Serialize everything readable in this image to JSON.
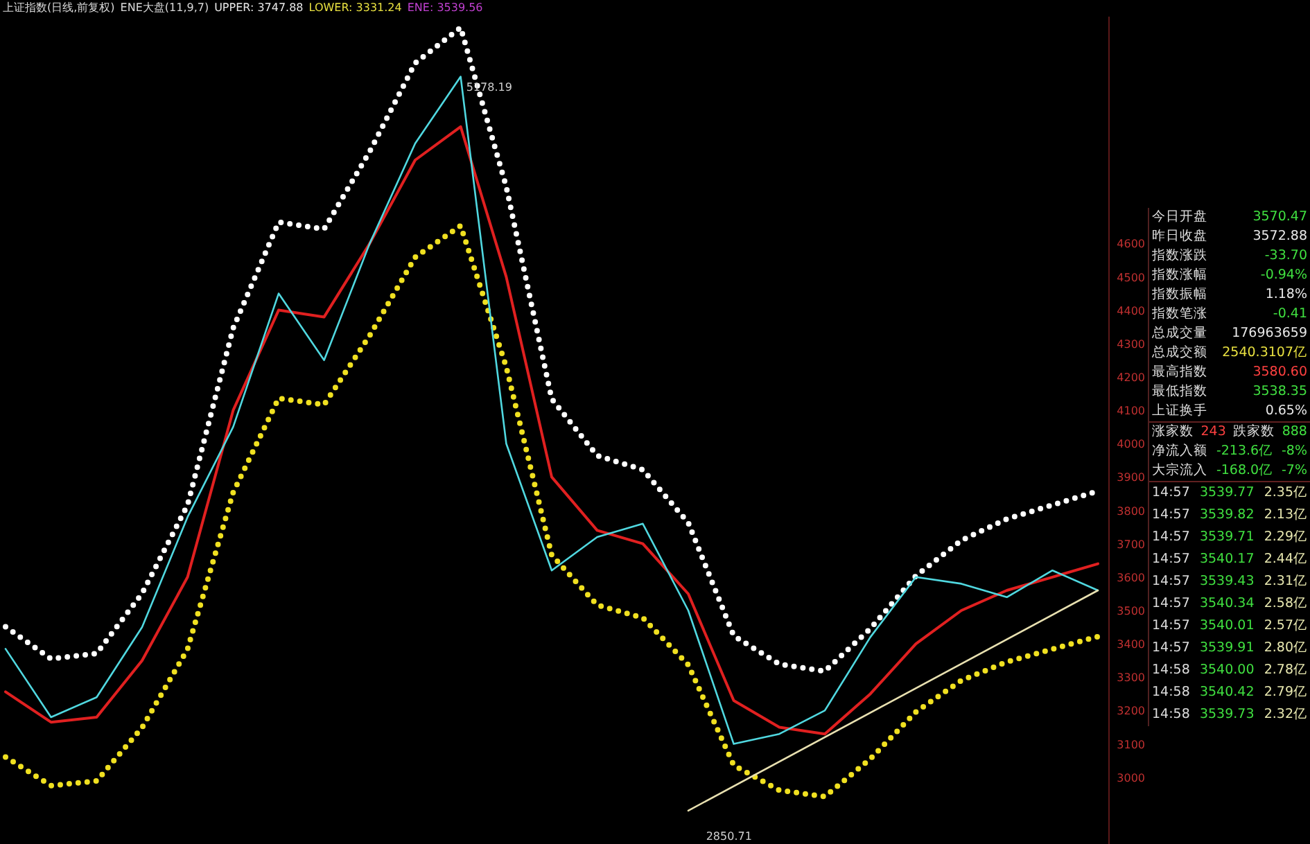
{
  "header": [
    {
      "text": "上证指数(日线,前复权)",
      "color": "#d8d8d8"
    },
    {
      "text": "ENE大盘(11,9,7)",
      "color": "#d8d8d8"
    },
    {
      "text": "UPPER: 3747.88",
      "color": "#e8e8e8"
    },
    {
      "text": "LOWER: 3331.24",
      "color": "#e8e040"
    },
    {
      "text": "ENE: 3539.56",
      "color": "#c040d0"
    }
  ],
  "chart": {
    "price_labels": [
      {
        "kind": "high",
        "text": "5178.19"
      },
      {
        "kind": "low",
        "text": "2850.71"
      }
    ],
    "chart_data": {
      "type": "line",
      "categories": [
        null,
        null,
        null,
        null,
        null,
        null,
        null,
        null,
        null,
        null,
        null,
        null,
        null,
        null,
        null,
        null,
        null,
        null,
        null,
        null,
        null,
        null,
        null,
        null,
        null
      ],
      "series": [
        {
          "color": "#ffffff",
          "line_style": "dotted",
          "values": [
            3451,
            3355,
            3371,
            3551,
            3816,
            4346,
            4664,
            4643,
            4876,
            5141,
            5247,
            4770,
            4134,
            3964,
            3922,
            3763,
            3424,
            3339,
            3318,
            3445,
            3604,
            3710,
            3774,
            3816,
            3858
          ]
        },
        {
          "color": "#e02020",
          "values": [
            3256,
            3165,
            3180,
            3350,
            3600,
            4100,
            4400,
            4380,
            4600,
            4850,
            4950,
            4500,
            3900,
            3740,
            3700,
            3550,
            3230,
            3150,
            3130,
            3250,
            3400,
            3500,
            3560,
            3600,
            3640
          ]
        },
        {
          "color": "#f0e020",
          "line_style": "dotted",
          "values": [
            3061,
            2975,
            2989,
            3149,
            3384,
            3854,
            4136,
            4117,
            4324,
            4559,
            4653,
            4230,
            3666,
            3516,
            3478,
            3337,
            3036,
            2961,
            2942,
            3055,
            3196,
            3290,
            3346,
            3384,
            3422
          ]
        },
        {
          "color": "#50d8e0",
          "values": [
            3385,
            3180,
            3240,
            3450,
            3780,
            4050,
            4450,
            4250,
            4600,
            4900,
            5100,
            4000,
            3620,
            3720,
            3760,
            3500,
            3100,
            3130,
            3200,
            3420,
            3600,
            3580,
            3540,
            3620,
            3560
          ]
        },
        {
          "color": "#e8e0b0",
          "values": [
            null,
            null,
            null,
            null,
            null,
            null,
            null,
            null,
            null,
            null,
            null,
            null,
            null,
            null,
            null,
            2900,
            null,
            null,
            null,
            null,
            null,
            null,
            null,
            null,
            3560
          ]
        }
      ],
      "ylim": [
        2800,
        5280
      ],
      "yticks": [
        3000,
        3100,
        3200,
        3300,
        3400,
        3500,
        3600,
        3700,
        3800,
        3900,
        4000,
        4100,
        4200,
        4300,
        4400,
        4500,
        4600
      ]
    }
  },
  "quote_panel": {
    "stats": [
      {
        "label": "今日开盘",
        "value": "3570.47",
        "color": "#40e040"
      },
      {
        "label": "昨日收盘",
        "value": "3572.88",
        "color": "#e8e8e8"
      },
      {
        "label": "指数涨跌",
        "value": "-33.70",
        "color": "#40e040"
      },
      {
        "label": "指数涨幅",
        "value": "-0.94%",
        "color": "#40e040"
      },
      {
        "label": "指数振幅",
        "value": "1.18%",
        "color": "#e8e8e8"
      },
      {
        "label": "指数笔涨",
        "value": "-0.41",
        "color": "#40e040"
      },
      {
        "label": "总成交量",
        "value": "176963659",
        "color": "#e8e8e8"
      },
      {
        "label": "总成交额",
        "value": "2540.3107亿",
        "color": "#e8e040"
      },
      {
        "label": "最高指数",
        "value": "3580.60",
        "color": "#ff4040"
      },
      {
        "label": "最低指数",
        "value": "3538.35",
        "color": "#40e040"
      },
      {
        "label": "上证换手",
        "value": "0.65%",
        "color": "#e8e8e8"
      }
    ],
    "breadth": {
      "up_label": "涨家数",
      "up_count": "243",
      "down_label": "跌家数",
      "down_count": "888"
    },
    "flows": [
      {
        "label": "净流入额",
        "amount": "-213.6亿",
        "ratio": "-8%"
      },
      {
        "label": "大宗流入",
        "amount": "-168.0亿",
        "ratio": "-7%"
      }
    ],
    "ticks": [
      {
        "time": "14:57",
        "price": "3539.77",
        "amount": "2.35亿"
      },
      {
        "time": "14:57",
        "price": "3539.82",
        "amount": "2.13亿"
      },
      {
        "time": "14:57",
        "price": "3539.71",
        "amount": "2.29亿"
      },
      {
        "time": "14:57",
        "price": "3540.17",
        "amount": "2.44亿"
      },
      {
        "time": "14:57",
        "price": "3539.43",
        "amount": "2.31亿"
      },
      {
        "time": "14:57",
        "price": "3540.34",
        "amount": "2.58亿"
      },
      {
        "time": "14:57",
        "price": "3540.01",
        "amount": "2.57亿"
      },
      {
        "time": "14:57",
        "price": "3539.91",
        "amount": "2.80亿"
      },
      {
        "time": "14:58",
        "price": "3540.00",
        "amount": "2.78亿"
      },
      {
        "time": "14:58",
        "price": "3540.42",
        "amount": "2.79亿"
      },
      {
        "time": "14:58",
        "price": "3539.73",
        "amount": "2.32亿"
      }
    ]
  }
}
